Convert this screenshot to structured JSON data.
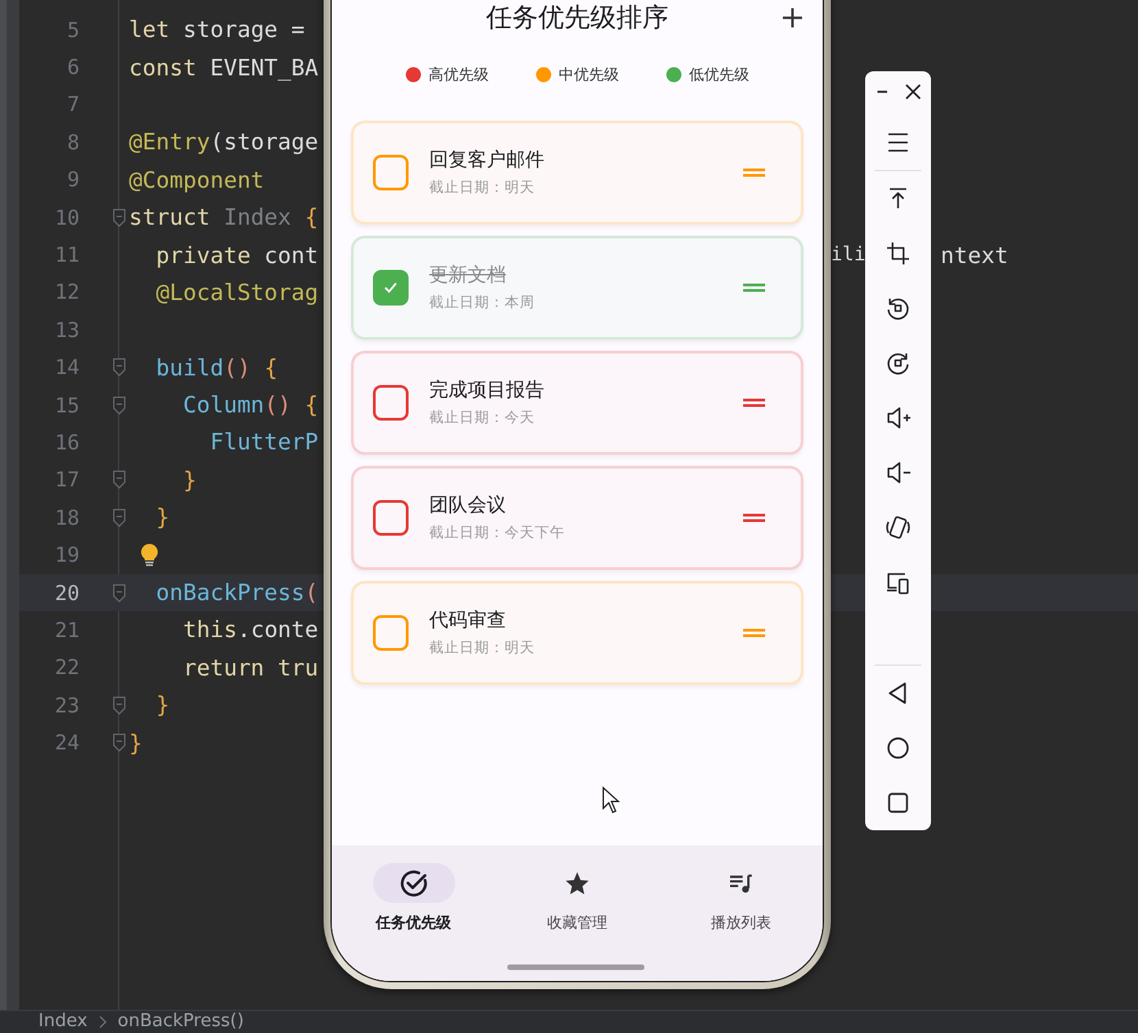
{
  "editor": {
    "lines": [
      {
        "num": "5",
        "fold": false,
        "current": false,
        "tokens": [
          {
            "t": "let",
            "kind": "kw"
          },
          {
            "t": " storage =",
            "kind": "plain"
          }
        ]
      },
      {
        "num": "6",
        "fold": false,
        "current": false,
        "tokens": [
          {
            "t": "const",
            "kind": "kw"
          },
          {
            "t": " EVENT_BA",
            "kind": "plain"
          }
        ]
      },
      {
        "num": "7",
        "fold": false,
        "current": false
      },
      {
        "num": "8",
        "fold": false,
        "current": false,
        "tokens": [
          {
            "t": "@Entry",
            "kind": "deco"
          },
          {
            "t": "(storage",
            "kind": "plain"
          }
        ]
      },
      {
        "num": "9",
        "fold": false,
        "current": false,
        "tokens": [
          {
            "t": "@Component",
            "kind": "deco"
          }
        ]
      },
      {
        "num": "10",
        "fold": true,
        "current": false,
        "tokens": [
          {
            "t": "struct ",
            "kind": "kw"
          },
          {
            "t": "Index",
            "kind": "dim"
          },
          {
            "t": " {",
            "kind": "brace"
          }
        ]
      },
      {
        "num": "11",
        "fold": false,
        "current": false,
        "tokens": [
          {
            "t": "  private",
            "kind": "kw"
          },
          {
            "t": " cont",
            "kind": "plain"
          }
        ],
        "tail": [
          {
            "t": "ili",
            "kind": "plain"
          },
          {
            "t": "ntext",
            "kind": "plain"
          }
        ]
      },
      {
        "num": "12",
        "fold": false,
        "current": false,
        "tokens": [
          {
            "t": "  @LocalStorag",
            "kind": "deco"
          }
        ]
      },
      {
        "num": "13",
        "fold": false,
        "current": false
      },
      {
        "num": "14",
        "fold": true,
        "current": false,
        "tokens": [
          {
            "t": "  build",
            "kind": "fn"
          },
          {
            "t": "()",
            "kind": "paren"
          },
          {
            "t": " {",
            "kind": "brace"
          }
        ]
      },
      {
        "num": "15",
        "fold": true,
        "current": false,
        "tokens": [
          {
            "t": "    Column",
            "kind": "fn"
          },
          {
            "t": "()",
            "kind": "paren"
          },
          {
            "t": " {",
            "kind": "brace"
          }
        ]
      },
      {
        "num": "16",
        "fold": false,
        "current": false,
        "tokens": [
          {
            "t": "      FlutterP",
            "kind": "fn"
          }
        ]
      },
      {
        "num": "17",
        "fold": true,
        "current": false,
        "tokens": [
          {
            "t": "    }",
            "kind": "brace"
          }
        ]
      },
      {
        "num": "18",
        "fold": true,
        "current": false,
        "tokens": [
          {
            "t": "  }",
            "kind": "brace"
          }
        ]
      },
      {
        "num": "19",
        "fold": false,
        "current": false,
        "hint": true
      },
      {
        "num": "20",
        "fold": true,
        "current": true,
        "tokens": [
          {
            "t": "  onBackPress",
            "kind": "fn"
          },
          {
            "t": "(",
            "kind": "paren"
          }
        ]
      },
      {
        "num": "21",
        "fold": false,
        "current": false,
        "tokens": [
          {
            "t": "    this",
            "kind": "kw"
          },
          {
            "t": ".conte",
            "kind": "plain"
          }
        ]
      },
      {
        "num": "22",
        "fold": false,
        "current": false,
        "tokens": [
          {
            "t": "    return tru",
            "kind": "kw"
          }
        ]
      },
      {
        "num": "23",
        "fold": true,
        "current": false,
        "tokens": [
          {
            "t": "  }",
            "kind": "brace"
          }
        ]
      },
      {
        "num": "24",
        "fold": true,
        "current": false,
        "tokens": [
          {
            "t": "}",
            "kind": "brace"
          }
        ]
      }
    ]
  },
  "breadcrumbs": [
    "Index",
    "onBackPress()"
  ],
  "phone": {
    "title": "任务优先级排序",
    "legend": [
      {
        "label": "高优先级",
        "color": "#e53935"
      },
      {
        "label": "中优先级",
        "color": "#ff9800"
      },
      {
        "label": "低优先级",
        "color": "#4caf50"
      }
    ],
    "tasks": [
      {
        "title": "回复客户邮件",
        "due": "截止日期：明天",
        "color": "#ff9800",
        "checked": false
      },
      {
        "title": "更新文档",
        "due": "截止日期：本周",
        "color": "#4caf50",
        "checked": true
      },
      {
        "title": "完成项目报告",
        "due": "截止日期：今天",
        "color": "#e53935",
        "checked": false
      },
      {
        "title": "团队会议",
        "due": "截止日期：今天下午",
        "color": "#e53935",
        "checked": false
      },
      {
        "title": "代码审查",
        "due": "截止日期：明天",
        "color": "#ff9800",
        "checked": false
      }
    ],
    "nav": [
      {
        "label": "任务优先级",
        "kind": "check",
        "selected": true
      },
      {
        "label": "收藏管理",
        "kind": "star",
        "selected": false
      },
      {
        "label": "播放列表",
        "kind": "playlist",
        "selected": false
      }
    ]
  }
}
